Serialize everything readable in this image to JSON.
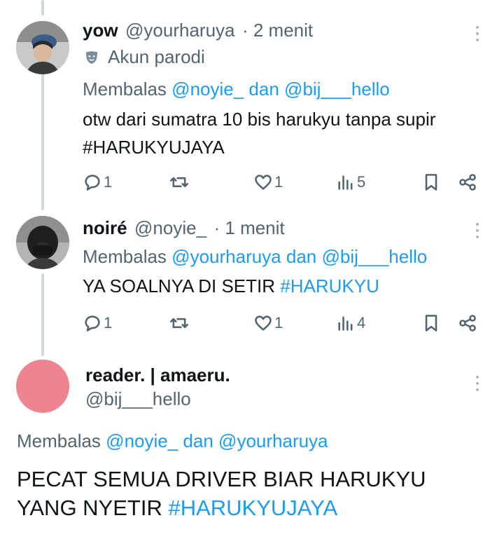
{
  "tweets": [
    {
      "name": "yow",
      "handle": "@yourharuya",
      "time": "· 2 menit",
      "badge": "Akun parodi",
      "reply_prefix": "Membalas",
      "reply_user1": "@noyie_",
      "reply_and": "dan",
      "reply_user2": "@bij___hello",
      "text": "otw dari sumatra 10 bis harukyu tanpa supir",
      "hashtag": "#HARUKYUJAYA",
      "replies": "1",
      "reposts": "",
      "likes": "1",
      "views": "5"
    },
    {
      "name": "noiré",
      "handle": "@noyie_",
      "time": "· 1 menit",
      "reply_prefix": "Membalas",
      "reply_user1": "@yourharuya",
      "reply_and": "dan",
      "reply_user2": "@bij___hello",
      "text": "YA SOALNYA DI SETIR",
      "hashtag": "#HARUKYU",
      "replies": "1",
      "reposts": "",
      "likes": "1",
      "views": "4"
    },
    {
      "name": "reader. | amaeru.",
      "handle": "@bij___hello",
      "reply_prefix": "Membalas",
      "reply_user1": "@noyie_",
      "reply_and": "dan",
      "reply_user2": "@yourharuya",
      "text_line1": "PECAT SEMUA DRIVER BIAR HARUKYU",
      "text_line2": "YANG NYETIR",
      "hashtag": "#HARUKYUJAYA"
    }
  ],
  "colors": {
    "link": "#1d9bf0",
    "secondary": "#536471",
    "thread_line": "#cfd9de",
    "avatar3": "#ef8491"
  },
  "icons": [
    "reply-icon",
    "repost-icon",
    "like-icon",
    "views-icon",
    "bookmark-icon",
    "share-icon",
    "more-icon",
    "parody-mask-icon"
  ]
}
